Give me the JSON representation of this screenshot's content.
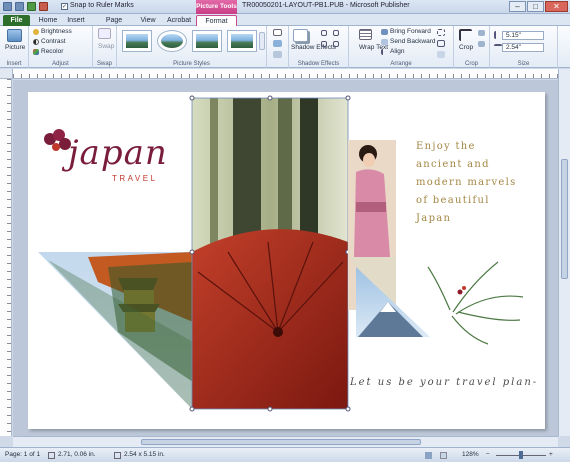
{
  "title_bar": {
    "snap_label": "Snap to Ruler Marks",
    "context_tab": "Picture Tools",
    "doc_title": "TR00050201-LAYOUT-PB1.PUB - Microsoft Publisher",
    "minimize": "–",
    "maximize": "□",
    "close": "✕"
  },
  "tabs": [
    "File",
    "Home",
    "Insert",
    "Page Design",
    "View",
    "Acrobat",
    "Format"
  ],
  "ribbon": {
    "insert": {
      "label": "Insert",
      "picture": "Picture"
    },
    "adjust": {
      "label": "Adjust",
      "brightness": "Brightness",
      "contrast": "Contrast",
      "recolor": "Recolor"
    },
    "swap": {
      "label": "Swap",
      "swap": "Swap"
    },
    "picture_styles": {
      "label": "Picture Styles"
    },
    "shadow": {
      "label": "Shadow Effects",
      "button": "Shadow Effects"
    },
    "arrange": {
      "label": "Arrange",
      "wrap": "Wrap Text",
      "bring_forward": "Bring Forward",
      "send_backward": "Send Backward",
      "align": "Align"
    },
    "crop": {
      "label": "Crop",
      "crop": "Crop"
    },
    "size": {
      "label": "Size",
      "height": "5.15\"",
      "width": "2.54\""
    }
  },
  "page_content": {
    "logo_main": "japan",
    "logo_sub": "TRAVEL",
    "headline": [
      "Enjoy the",
      "ancient and",
      "modern marvels",
      "of beautiful",
      "Japan"
    ],
    "tagline": "Let us be your travel plan-"
  },
  "status_bar": {
    "page": "Page: 1 of 1",
    "position": "2.71, 0.06 in.",
    "size": "2.54 x 5.15 in.",
    "zoom": "128%"
  },
  "colors": {
    "accent_file": "#2e6e2b",
    "context_tab": "#c83d86",
    "headline": "#a38744",
    "logo_maroon": "#7a1d3b",
    "logo_red": "#c0392b"
  }
}
